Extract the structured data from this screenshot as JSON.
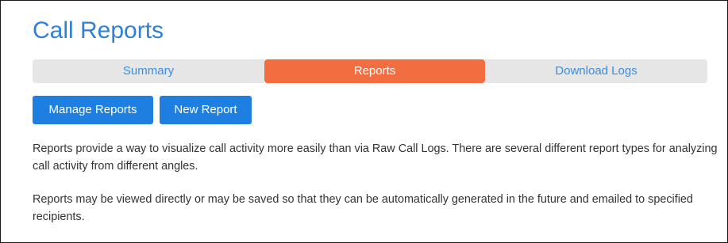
{
  "page": {
    "title": "Call Reports"
  },
  "tabs": [
    {
      "label": "Summary",
      "active": false
    },
    {
      "label": "Reports",
      "active": true
    },
    {
      "label": "Download Logs",
      "active": false
    }
  ],
  "toolbar": {
    "manage_reports_label": "Manage Reports",
    "new_report_label": "New Report"
  },
  "content": {
    "paragraph_1": "Reports provide a way to visualize call activity more easily than via Raw Call Logs. There are several different report types for analyzing call activity from different angles.",
    "paragraph_2": "Reports may be viewed directly or may be saved so that they can be automatically generated in the future and emailed to specified recipients."
  },
  "colors": {
    "title": "#2f80d9",
    "active_tab": "#f26e40",
    "inactive_tab": "#e6e6e6",
    "inactive_tab_text": "#3a8de0",
    "button": "#1f7fe0",
    "body_text": "#333333"
  }
}
